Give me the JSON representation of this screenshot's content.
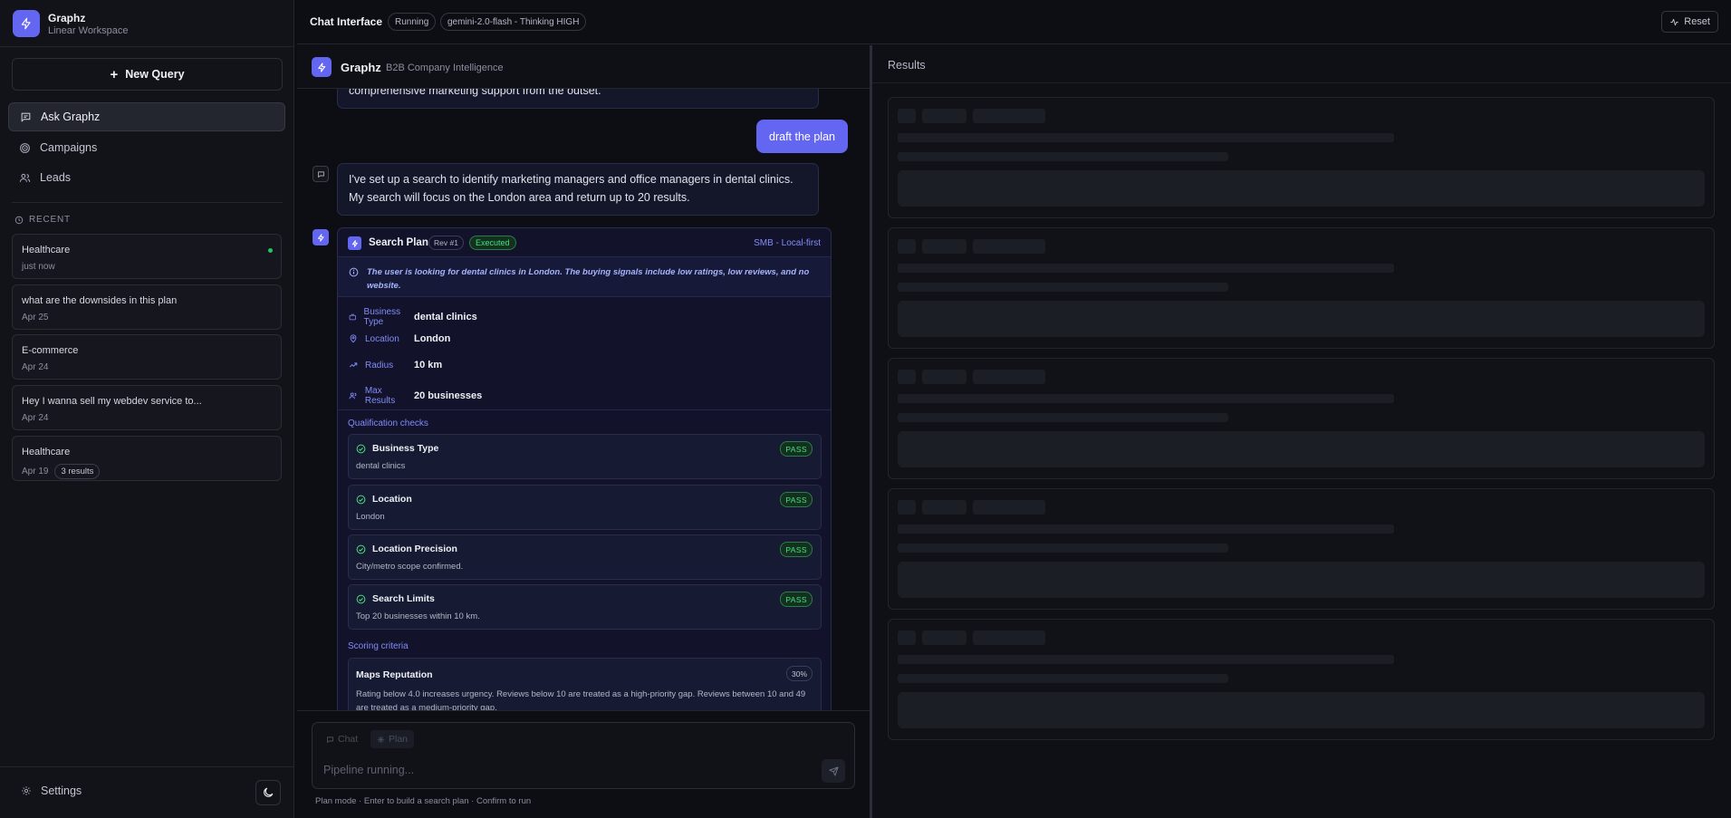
{
  "app": {
    "name": "Graphz",
    "workspace": "Linear Workspace"
  },
  "sidebar": {
    "new_query": "New Query",
    "nav": [
      {
        "label": "Ask Graphz",
        "icon": "chat-icon",
        "active": true
      },
      {
        "label": "Campaigns",
        "icon": "target-icon",
        "active": false
      },
      {
        "label": "Leads",
        "icon": "users-icon",
        "active": false
      }
    ],
    "recent_label": "RECENT",
    "recent": [
      {
        "title": "Healthcare",
        "date": "just now",
        "badge": "",
        "live": true
      },
      {
        "title": "what are the downsides in this plan",
        "date": "Apr 25",
        "badge": ""
      },
      {
        "title": "E-commerce",
        "date": "Apr 24",
        "badge": ""
      },
      {
        "title": "Hey I wanna sell my webdev service to...",
        "date": "Apr 24",
        "badge": ""
      },
      {
        "title": "Healthcare",
        "date": "Apr 19",
        "badge": "3 results"
      }
    ],
    "settings": "Settings"
  },
  "topbar": {
    "title": "Chat Interface",
    "status": "Running",
    "model": "gemini-2.0-flash - Thinking HIGH",
    "reset": "Reset"
  },
  "chat": {
    "header_title": "Graphz",
    "header_sub": "B2B Company Intelligence",
    "prev_message_tail": "comprehensive marketing support from the outset.",
    "user_message": "draft the plan",
    "ai_message": "I've set up a search to identify marketing managers and office managers in dental clinics. My search will focus on the London area and return up to 20 results.",
    "plan": {
      "title": "Search Plan",
      "rev": "Rev #1",
      "status": "Executed",
      "mode": "SMB - Local-first",
      "note": "The user is looking for dental clinics in London. The buying signals include low ratings, low reviews, and no website.",
      "fields": [
        {
          "key": "Business Type",
          "value": "dental clinics",
          "icon": "briefcase-icon"
        },
        {
          "key": "Location",
          "value": "London",
          "icon": "map-pin-icon"
        },
        {
          "key": "Radius",
          "value": "10 km",
          "icon": "trend-icon"
        },
        {
          "key": "Max Results",
          "value": "20 businesses",
          "icon": "users-icon"
        }
      ],
      "checks_label": "Qualification checks",
      "checks": [
        {
          "title": "Business Type",
          "desc": "dental clinics",
          "result": "PASS"
        },
        {
          "title": "Location",
          "desc": "London",
          "result": "PASS"
        },
        {
          "title": "Location Precision",
          "desc": "City/metro scope confirmed.",
          "result": "PASS"
        },
        {
          "title": "Search Limits",
          "desc": "Top 20 businesses within 10 km.",
          "result": "PASS"
        }
      ],
      "scoring_label": "Scoring criteria",
      "scoring": [
        {
          "title": "Maps Reputation",
          "weight": "30%",
          "desc": "Rating below 4.0 increases urgency. Reviews below 10 are treated as a high-priority gap. Reviews between 10 and 49 are treated as a medium-priority gap."
        }
      ]
    }
  },
  "composer": {
    "tab_chat": "Chat",
    "tab_plan": "Plan",
    "placeholder": "Pipeline running...",
    "hint": "Plan mode · Enter to build a search plan · Confirm to run"
  },
  "results": {
    "title": "Results"
  },
  "colors": {
    "accent": "#6366f1",
    "success": "#4ade80",
    "background": "#0d0e13"
  }
}
